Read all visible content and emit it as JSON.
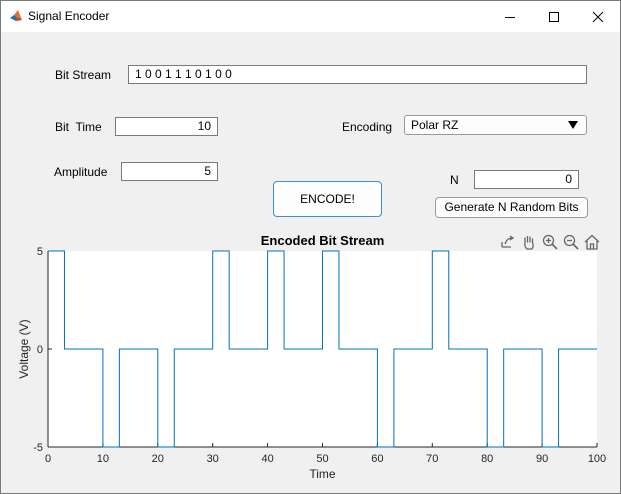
{
  "window": {
    "title": "Signal Encoder",
    "app_icon": "matlab-icon",
    "controls": [
      "minimize-icon",
      "maximize-icon",
      "close-icon"
    ]
  },
  "form": {
    "bitstream_label": "Bit Stream",
    "bitstream_value": "1 0 0 1 1 1 0 1 0 0",
    "bittime_label": "Bit  Time",
    "bittime_value": "10",
    "amplitude_label": "Amplitude",
    "amplitude_value": "5",
    "encoding_label": "Encoding",
    "encoding_value": "Polar RZ",
    "n_label": "N",
    "n_value": "0",
    "encode_button": "ENCODE!",
    "random_button": "Generate N Random Bits"
  },
  "toolbar": {
    "icons": [
      "export-icon",
      "pan-hand-icon",
      "zoom-in-icon",
      "zoom-out-icon",
      "home-icon"
    ]
  },
  "chart_data": {
    "type": "line",
    "title": "Encoded Bit Stream",
    "xlabel": "Time",
    "ylabel": "Voltage (V)",
    "xlim": [
      0,
      100
    ],
    "ylim": [
      -5,
      5
    ],
    "xticks": [
      0,
      10,
      20,
      30,
      40,
      50,
      60,
      70,
      80,
      90,
      100
    ],
    "yticks": [
      -5,
      0,
      5
    ],
    "grid": false,
    "line_color": "#0072bd",
    "series": [
      {
        "x": [
          0,
          3,
          3,
          10,
          10,
          13,
          13,
          20,
          20,
          23,
          23,
          30,
          30,
          33,
          33,
          40,
          40,
          43,
          43,
          50,
          50,
          53,
          53,
          60,
          60,
          63,
          63,
          70,
          70,
          73,
          73,
          80,
          80,
          83,
          83,
          90,
          90,
          93,
          93,
          100
        ],
        "y": [
          5,
          5,
          0,
          0,
          -5,
          -5,
          0,
          0,
          -5,
          -5,
          0,
          0,
          5,
          5,
          0,
          0,
          5,
          5,
          0,
          0,
          5,
          5,
          0,
          0,
          -5,
          -5,
          0,
          0,
          5,
          5,
          0,
          0,
          -5,
          -5,
          0,
          0,
          -5,
          -5,
          0,
          0
        ]
      }
    ]
  }
}
